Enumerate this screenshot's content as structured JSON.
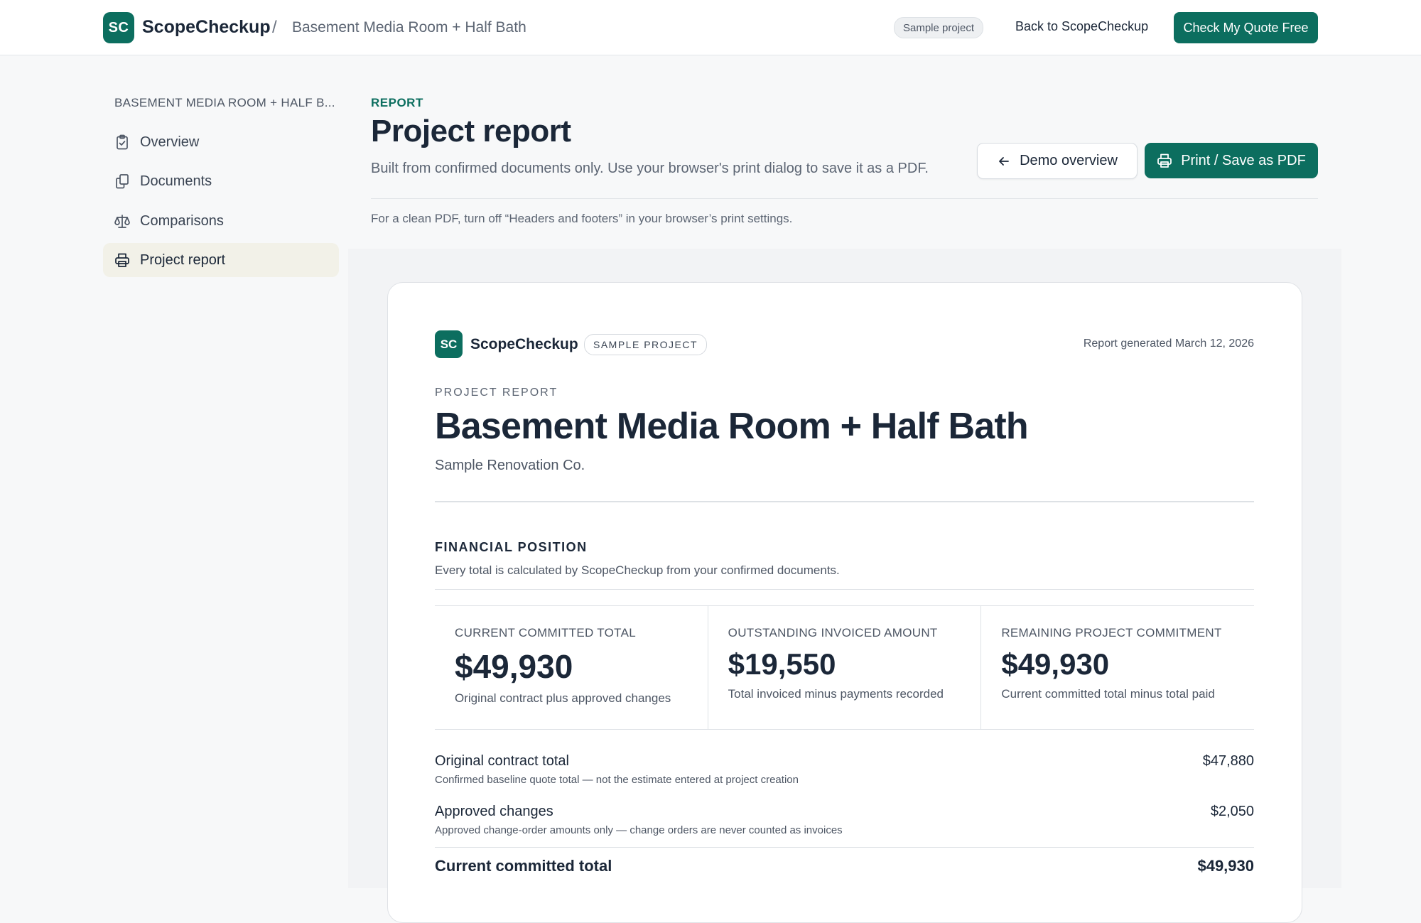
{
  "header": {
    "logo_initials": "SC",
    "brand": "ScopeCheckup",
    "separator": "/",
    "project_name": "Basement Media Room + Half Bath",
    "sample_badge": "Sample project",
    "back_link": "Back to ScopeCheckup",
    "cta_label": "Check My Quote Free"
  },
  "sidebar": {
    "heading": "BASEMENT MEDIA ROOM + HALF B...",
    "items": [
      {
        "label": "Overview",
        "icon": "clipboard-check-icon",
        "active": false
      },
      {
        "label": "Documents",
        "icon": "documents-icon",
        "active": false
      },
      {
        "label": "Comparisons",
        "icon": "scale-icon",
        "active": false
      },
      {
        "label": "Project report",
        "icon": "printer-icon",
        "active": true
      }
    ]
  },
  "page": {
    "kicker": "REPORT",
    "title": "Project report",
    "subtitle": "Built from confirmed documents only. Use your browser's print dialog to save it as a PDF.",
    "demo_button": "Demo overview",
    "print_button": "Print / Save as PDF",
    "print_note": "For a clean PDF, turn off “Headers and footers” in your browser’s print settings."
  },
  "report": {
    "logo_initials": "SC",
    "brand": "ScopeCheckup",
    "badge": "SAMPLE PROJECT",
    "generated": "Report generated March 12, 2026",
    "kicker": "PROJECT REPORT",
    "title": "Basement Media Room + Half Bath",
    "company": "Sample Renovation Co.",
    "financial": {
      "heading": "FINANCIAL POSITION",
      "subheading": "Every total is calculated by ScopeCheckup from your confirmed documents.",
      "metrics": [
        {
          "label": "CURRENT COMMITTED TOTAL",
          "value": "$49,930",
          "note": "Original contract plus approved changes"
        },
        {
          "label": "OUTSTANDING INVOICED AMOUNT",
          "value": "$19,550",
          "note": "Total invoiced minus payments recorded"
        },
        {
          "label": "REMAINING PROJECT COMMITMENT",
          "value": "$49,930",
          "note": "Current committed total minus total paid"
        }
      ],
      "lines": [
        {
          "label": "Original contract total",
          "desc": "Confirmed baseline quote total — not the estimate entered at project creation",
          "amount": "$47,880"
        },
        {
          "label": "Approved changes",
          "desc": "Approved change-order amounts only — change orders are never counted as invoices",
          "amount": "$2,050"
        }
      ],
      "total_label": "Current committed total",
      "total_amount": "$49,930"
    }
  },
  "colors": {
    "brand": "#0c6e5f",
    "active_nav_bg": "#f2f1e8",
    "text_dark": "#1b2738"
  }
}
